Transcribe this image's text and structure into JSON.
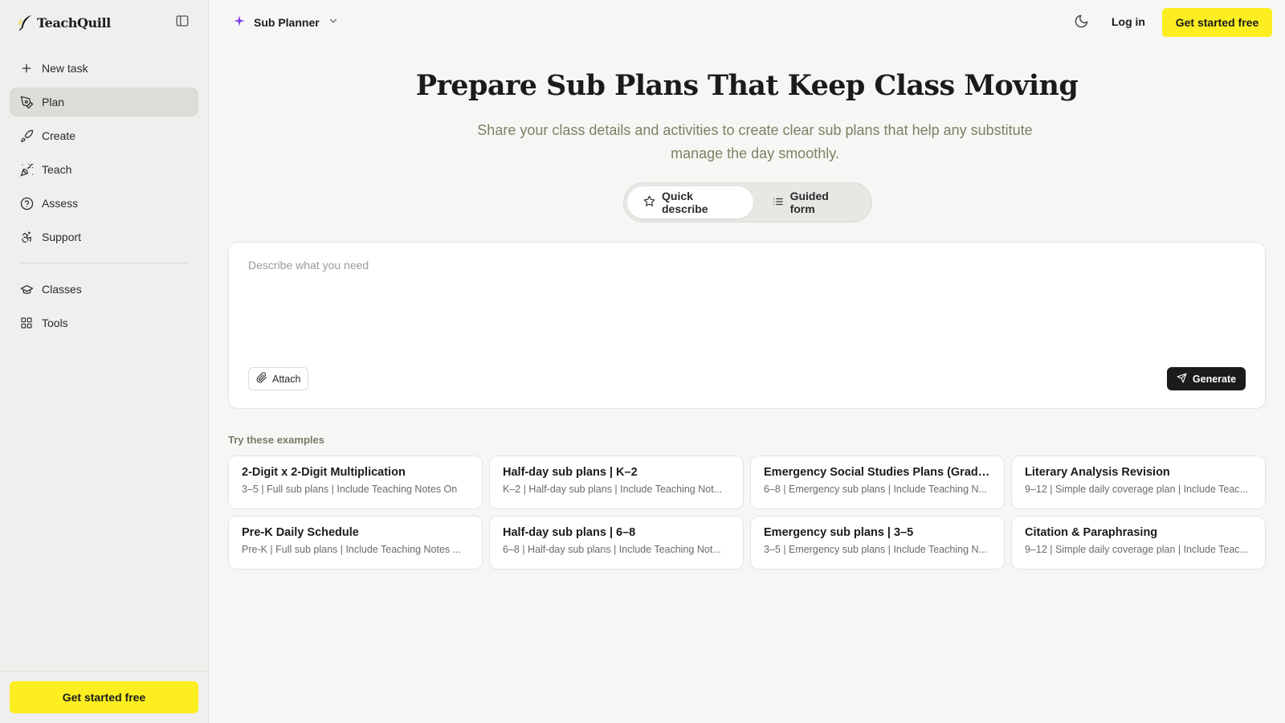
{
  "brand": {
    "name": "TeachQuill",
    "logo_icon": "quill-icon"
  },
  "sidebar": {
    "toggle_icon": "sidebar-toggle-icon",
    "items": [
      {
        "label": "New task",
        "icon": "plus-icon"
      },
      {
        "label": "Plan",
        "icon": "pen-tool-icon",
        "active": true
      },
      {
        "label": "Create",
        "icon": "rocket-icon"
      },
      {
        "label": "Teach",
        "icon": "party-popper-icon"
      },
      {
        "label": "Assess",
        "icon": "help-circle-icon"
      },
      {
        "label": "Support",
        "icon": "accessibility-icon"
      }
    ],
    "secondary_items": [
      {
        "label": "Classes",
        "icon": "graduation-cap-icon"
      },
      {
        "label": "Tools",
        "icon": "grid-icon"
      }
    ],
    "cta_label": "Get started free"
  },
  "header": {
    "tool_name": "Sub Planner",
    "tool_icon": "sparkle-icon",
    "theme_icon": "moon-icon",
    "login_label": "Log in",
    "cta_label": "Get started free"
  },
  "hero": {
    "title": "Prepare Sub Plans That Keep Class Moving",
    "subtitle": "Share your class details and activities to create clear sub plans that help any substitute manage the day smoothly."
  },
  "mode_tabs": [
    {
      "label": "Quick describe",
      "icon": "star-icon",
      "active": true
    },
    {
      "label": "Guided form",
      "icon": "list-icon",
      "active": false
    }
  ],
  "composer": {
    "placeholder": "Describe what you need",
    "value": "",
    "attach_label": "Attach",
    "generate_label": "Generate"
  },
  "examples": {
    "label": "Try these examples",
    "cards": [
      {
        "title": "2-Digit x 2-Digit Multiplication",
        "meta": "3–5 | Full sub plans | Include Teaching Notes On"
      },
      {
        "title": "Half-day sub plans | K–2",
        "meta": "K–2 | Half-day sub plans | Include Teaching Not..."
      },
      {
        "title": "Emergency Social Studies Plans (Grade...",
        "meta": "6–8 | Emergency sub plans | Include Teaching N..."
      },
      {
        "title": "Literary Analysis Revision",
        "meta": "9–12 | Simple daily coverage plan | Include Teac..."
      },
      {
        "title": "Pre-K Daily Schedule",
        "meta": "Pre-K | Full sub plans | Include Teaching Notes ..."
      },
      {
        "title": "Half-day sub plans | 6–8",
        "meta": "6–8 | Half-day sub plans | Include Teaching Not..."
      },
      {
        "title": "Emergency sub plans | 3–5",
        "meta": "3–5 | Emergency sub plans | Include Teaching N..."
      },
      {
        "title": "Citation & Paraphrasing",
        "meta": "9–12 | Simple daily coverage plan | Include Teac..."
      }
    ]
  },
  "colors": {
    "accent_yellow": "#fdee21",
    "sparkle_purple": "#7b3fe4",
    "dark": "#1b1b1b",
    "subtitle": "#7f8063"
  }
}
